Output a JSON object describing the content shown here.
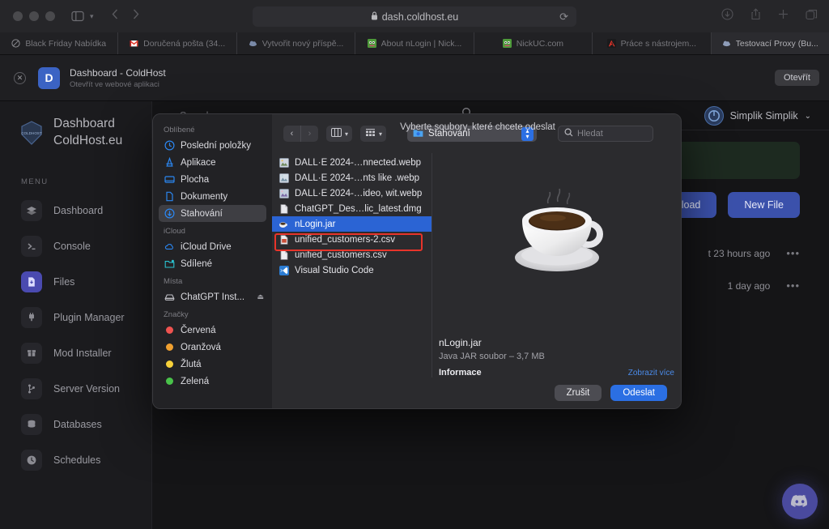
{
  "browser": {
    "url": "dash.coldhost.eu",
    "lock_icon": "lock-icon",
    "reload_icon": "reload-icon",
    "back_icon": "chevron-left-icon",
    "forward_icon": "chevron-right-icon",
    "sidebar_icon": "sidebar-toggle-icon",
    "downloads_icon": "download-icon",
    "share_icon": "share-icon",
    "newtab_icon": "plus-icon",
    "taboverview_icon": "tab-overview-icon",
    "tabs": [
      {
        "label": "Black Friday Nabídka",
        "favicon": "prohibited-icon",
        "active": false
      },
      {
        "label": "Doručená pošta (34...",
        "favicon": "gmail-icon",
        "active": false
      },
      {
        "label": "Vytvořit nový příspě...",
        "favicon": "cloud-icon",
        "active": false
      },
      {
        "label": "About nLogin | Nick...",
        "favicon": "nlogin-icon",
        "active": false
      },
      {
        "label": "NickUC.com",
        "favicon": "nickuc-icon",
        "active": false
      },
      {
        "label": "Práce s nástrojem...",
        "favicon": "adobe-icon",
        "active": false
      },
      {
        "label": "Testovací Proxy (Bu...",
        "favicon": "cloud-icon",
        "active": true
      }
    ]
  },
  "app_banner": {
    "icon_letter": "D",
    "title": "Dashboard - ColdHost",
    "subtitle": "Otevřít ve webové aplikaci",
    "open_button": "Otevřít",
    "close_icon": "close-icon"
  },
  "dashboard": {
    "brand": {
      "line1": "Dashboard",
      "line2": "ColdHost.eu",
      "logo_icon": "coldhost-logo-icon"
    },
    "menu_label": "MENU",
    "menu_items": [
      {
        "label": "Dashboard",
        "icon": "layers-icon",
        "active": false
      },
      {
        "label": "Console",
        "icon": "terminal-icon",
        "active": false
      },
      {
        "label": "Files",
        "icon": "file-download-icon",
        "active": true
      },
      {
        "label": "Plugin Manager",
        "icon": "plug-icon",
        "active": false
      },
      {
        "label": "Mod Installer",
        "icon": "box-icon",
        "active": false
      },
      {
        "label": "Server Version",
        "icon": "branch-icon",
        "active": false
      },
      {
        "label": "Databases",
        "icon": "database-icon",
        "active": false
      },
      {
        "label": "Schedules",
        "icon": "clock-icon",
        "active": false
      }
    ],
    "search_placeholder": "Search",
    "search_icon": "search-icon",
    "account": {
      "name": "Simplik Simplik",
      "avatar_icon": "user-avatar-icon",
      "chevron": "chevron-down-icon"
    },
    "buttons": {
      "upload": "Upload",
      "new_file": "New File"
    },
    "file_rows": [
      {
        "modified": "t 23 hours ago",
        "menu_icon": "ellipsis-icon"
      },
      {
        "modified": "1 day ago",
        "menu_icon": "ellipsis-icon"
      }
    ],
    "discord_icon": "discord-icon"
  },
  "file_dialog": {
    "title": "Vyberte soubory, které chcete odeslat",
    "toolbar": {
      "back_icon": "chevron-left-icon",
      "forward_icon": "chevron-right-icon",
      "column-view_icon": "column-view-icon",
      "group-view_icon": "group-view-icon",
      "chevron_icon": "chevron-down-icon",
      "path_value": "Stahování",
      "path_folder_icon": "folder-download-icon",
      "stepper_icon": "updown-stepper-icon",
      "search_placeholder": "Hledat",
      "search_icon": "search-icon"
    },
    "sidebar": {
      "sections": [
        {
          "label": "Oblíbené",
          "items": [
            {
              "label": "Poslední položky",
              "icon": "recents-clock-icon",
              "selected": false
            },
            {
              "label": "Aplikace",
              "icon": "applications-icon",
              "selected": false
            },
            {
              "label": "Plocha",
              "icon": "desktop-icon",
              "selected": false
            },
            {
              "label": "Dokumenty",
              "icon": "documents-icon",
              "selected": false
            },
            {
              "label": "Stahování",
              "icon": "downloads-icon",
              "selected": true
            }
          ]
        },
        {
          "label": "iCloud",
          "items": [
            {
              "label": "iCloud Drive",
              "icon": "icloud-icon",
              "selected": false
            },
            {
              "label": "Sdílené",
              "icon": "shared-folder-icon",
              "selected": false
            }
          ]
        },
        {
          "label": "Místa",
          "items": [
            {
              "label": "ChatGPT Inst...",
              "icon": "disk-icon",
              "selected": false,
              "eject": "eject-icon"
            }
          ]
        },
        {
          "label": "Značky",
          "items": [
            {
              "label": "Červená",
              "icon": "tag-dot-icon",
              "color": "#ef5350",
              "selected": false
            },
            {
              "label": "Oranžová",
              "icon": "tag-dot-icon",
              "color": "#f0a030",
              "selected": false
            },
            {
              "label": "Žlutá",
              "icon": "tag-dot-icon",
              "color": "#f7d13a",
              "selected": false
            },
            {
              "label": "Zelená",
              "icon": "tag-dot-icon",
              "color": "#49c24a",
              "selected": false
            }
          ]
        }
      ]
    },
    "files": [
      {
        "name": "DALL·E 2024-…nnected.webp",
        "icon": "image-file-icon",
        "selected": false
      },
      {
        "name": "DALL·E 2024-…nts like .webp",
        "icon": "image-file-icon",
        "selected": false
      },
      {
        "name": "DALL·E 2024-…ideo, wit.webp",
        "icon": "image-file-icon",
        "selected": false
      },
      {
        "name": "ChatGPT_Des…lic_latest.dmg",
        "icon": "dmg-file-icon",
        "selected": false
      },
      {
        "name": "nLogin.jar",
        "icon": "jar-file-icon",
        "selected": true
      },
      {
        "name": "unified_customers-2.csv",
        "icon": "csv-file-icon",
        "selected": false
      },
      {
        "name": "unified_customers.csv",
        "icon": "csv-file-icon",
        "selected": false
      },
      {
        "name": "Visual Studio Code",
        "icon": "vscode-icon",
        "selected": false
      }
    ],
    "preview": {
      "art_icon": "java-coffee-cup-icon",
      "name": "nLogin.jar",
      "subtitle": "Java JAR soubor – 3,7 MB",
      "info_label": "Informace",
      "show_more": "Zobrazit více"
    },
    "footer": {
      "cancel": "Zrušit",
      "submit": "Odeslat"
    }
  },
  "colors": {
    "accent_blue": "#2b6fe3",
    "dashboard_blue": "#3b51ab",
    "selection_red": "#e8342a",
    "discord_purple": "#4a4a9e"
  }
}
